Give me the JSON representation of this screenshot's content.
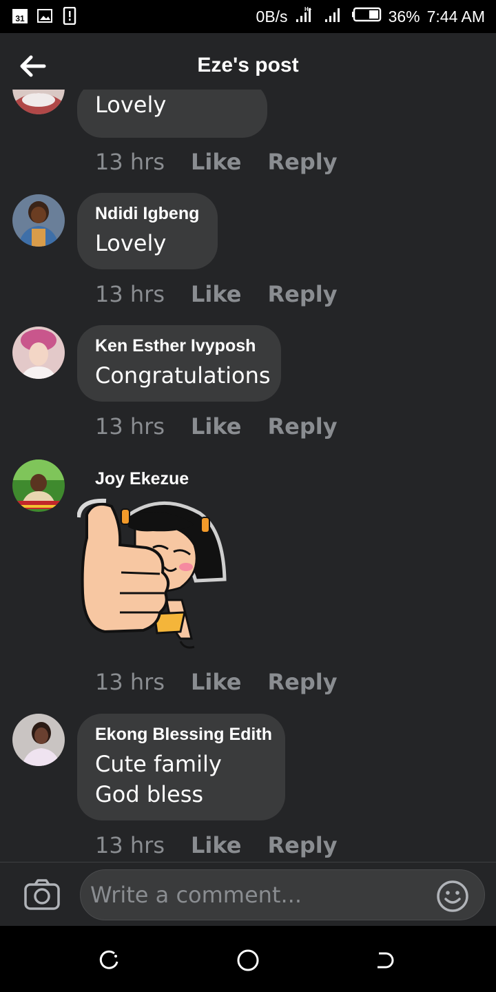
{
  "status_bar": {
    "left_icons": [
      "calendar-icon",
      "image-icon",
      "alert-icon"
    ],
    "calendar_day": "31",
    "net_speed": "0B/s",
    "network_badge": "H+",
    "battery": "36%",
    "time": "7:44 AM"
  },
  "header": {
    "title": "Eze's post"
  },
  "comments": [
    {
      "author": "",
      "text": "Lovely",
      "time": "13 hrs",
      "like": "Like",
      "reply": "Reply"
    },
    {
      "author": "Ndidi Igbeng",
      "text": "Lovely",
      "time": "13 hrs",
      "like": "Like",
      "reply": "Reply"
    },
    {
      "author": "Ken Esther Ivyposh",
      "text": "Congratulations",
      "time": "13 hrs",
      "like": "Like",
      "reply": "Reply"
    },
    {
      "author": "Joy Ekezue",
      "sticker": "thumbs-up-girl-sticker",
      "time": "13 hrs",
      "like": "Like",
      "reply": "Reply"
    },
    {
      "author": "Ekong Blessing Edith",
      "text": "Cute family\nGod bless",
      "time": "13 hrs",
      "like": "Like",
      "reply": "Reply"
    }
  ],
  "composer": {
    "placeholder": "Write a comment..."
  },
  "colors": {
    "background": "#242527",
    "bubble": "#3a3b3c",
    "meta_text": "#8a8d91"
  }
}
